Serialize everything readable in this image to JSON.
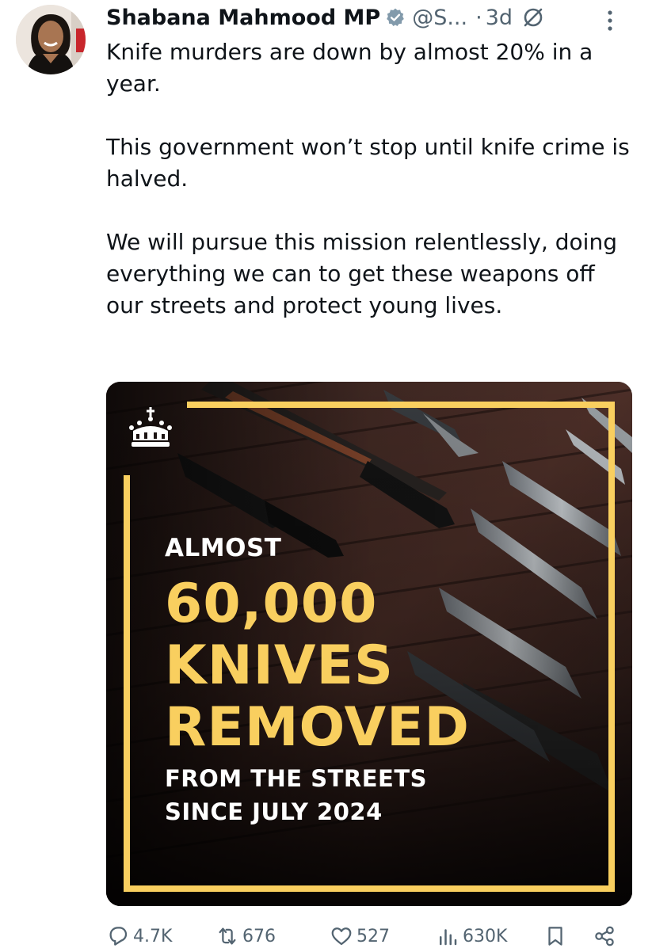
{
  "tweet": {
    "author_name": "Shabana Mahmood MP",
    "handle": "@S...",
    "separator": "·",
    "time": "3d",
    "verified_icon": "verified-badge-icon",
    "grok_icon": "grok-icon",
    "more_icon": "more-vertical-icon",
    "text_paragraphs": [
      "Knife murders are down by almost 20% in a year.",
      "This government won’t stop until knife crime is halved.",
      "We will pursue this mission relentlessly, doing everything we can to get these weapons off our streets and protect young lives."
    ]
  },
  "media": {
    "line1": "ALMOST",
    "line2": "60,000",
    "line3": "KNIVES",
    "line4": "REMOVED",
    "line5": "FROM THE STREETS",
    "line6": "SINCE JULY 2024",
    "crest_icon": "crown-crest-icon",
    "accent_color": "#f9cf5f"
  },
  "actions": {
    "replies": "4.7K",
    "reposts": "676",
    "likes": "527",
    "views": "630K",
    "reply_icon": "reply-icon",
    "repost_icon": "repost-icon",
    "like_icon": "heart-icon",
    "views_icon": "views-bar-chart-icon",
    "bookmark_icon": "bookmark-icon",
    "share_icon": "share-icon"
  }
}
